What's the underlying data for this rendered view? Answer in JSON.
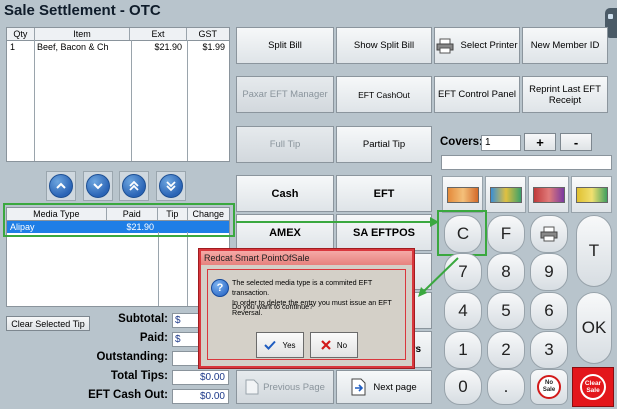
{
  "window": {
    "title": "Sale Settlement - OTC"
  },
  "items_table": {
    "headers": [
      "Qty",
      "Item",
      "Ext",
      "GST"
    ],
    "rows": [
      {
        "qty": "1",
        "item": "Beef, Bacon & Ch",
        "ext": "$21.90",
        "gst": "$1.99"
      }
    ]
  },
  "media_table": {
    "headers": [
      "Media Type",
      "Paid",
      "Tip",
      "Change"
    ],
    "rows": [
      {
        "media": "Alipay",
        "paid": "$21.90",
        "tip": "",
        "change": ""
      }
    ]
  },
  "buttons": {
    "split_bill": "Split Bill",
    "show_split_bill": "Show Split Bill",
    "select_printer": "Select Printer",
    "new_member_id": "New Member ID",
    "eft_manager": "Paxar EFT Manager",
    "eft_cashout": "EFT CashOut",
    "eft_control_panel": "EFT Control Panel",
    "reprint_last_eft": "Reprint Last EFT Receipt",
    "full_tip": "Full Tip",
    "partial_tip": "Partial Tip",
    "cash": "Cash",
    "eft": "EFT",
    "amex": "AMEX",
    "sa_eftpos": "SA EFTPOS",
    "rs": "rs",
    "previous_page": "Previous Page",
    "next_page": "Next page",
    "clear_selected_tip": "Clear Selected Tip"
  },
  "covers": {
    "label": "Covers:",
    "value": "1",
    "plus": "+",
    "minus": "-"
  },
  "keypad": {
    "c": "C",
    "f": "F",
    "t": "T",
    "ok": "OK",
    "k7": "7",
    "k8": "8",
    "k9": "9",
    "k4": "4",
    "k5": "5",
    "k6": "6",
    "k1": "1",
    "k2": "2",
    "k3": "3",
    "k0": "0",
    "dot": ".",
    "no_sale": "No Sale",
    "clear_sale": "Clear Sale"
  },
  "totals": {
    "subtotal_label": "Subtotal:",
    "subtotal": "$",
    "paid_label": "Paid:",
    "paid": "$",
    "outstanding_label": "Outstanding:",
    "outstanding": "",
    "total_tips_label": "Total Tips:",
    "total_tips": "$0.00",
    "eft_cash_out_label": "EFT Cash Out:",
    "eft_cash_out": "$0.00"
  },
  "dialog": {
    "title": "Redcat Smart PointOfSale",
    "message_line1": "The selected media type is a commited EFT transaction.",
    "message_line2": "In order to delete the entry you must issue an EFT Reversal.",
    "question": "Do you want to continue?",
    "yes": "Yes",
    "no": "No"
  },
  "colors": {
    "highlight": "#1e7ee6",
    "annotation": "#3aa83f",
    "dialog_border": "#d9373d",
    "clear_sale": "#e3161b"
  }
}
